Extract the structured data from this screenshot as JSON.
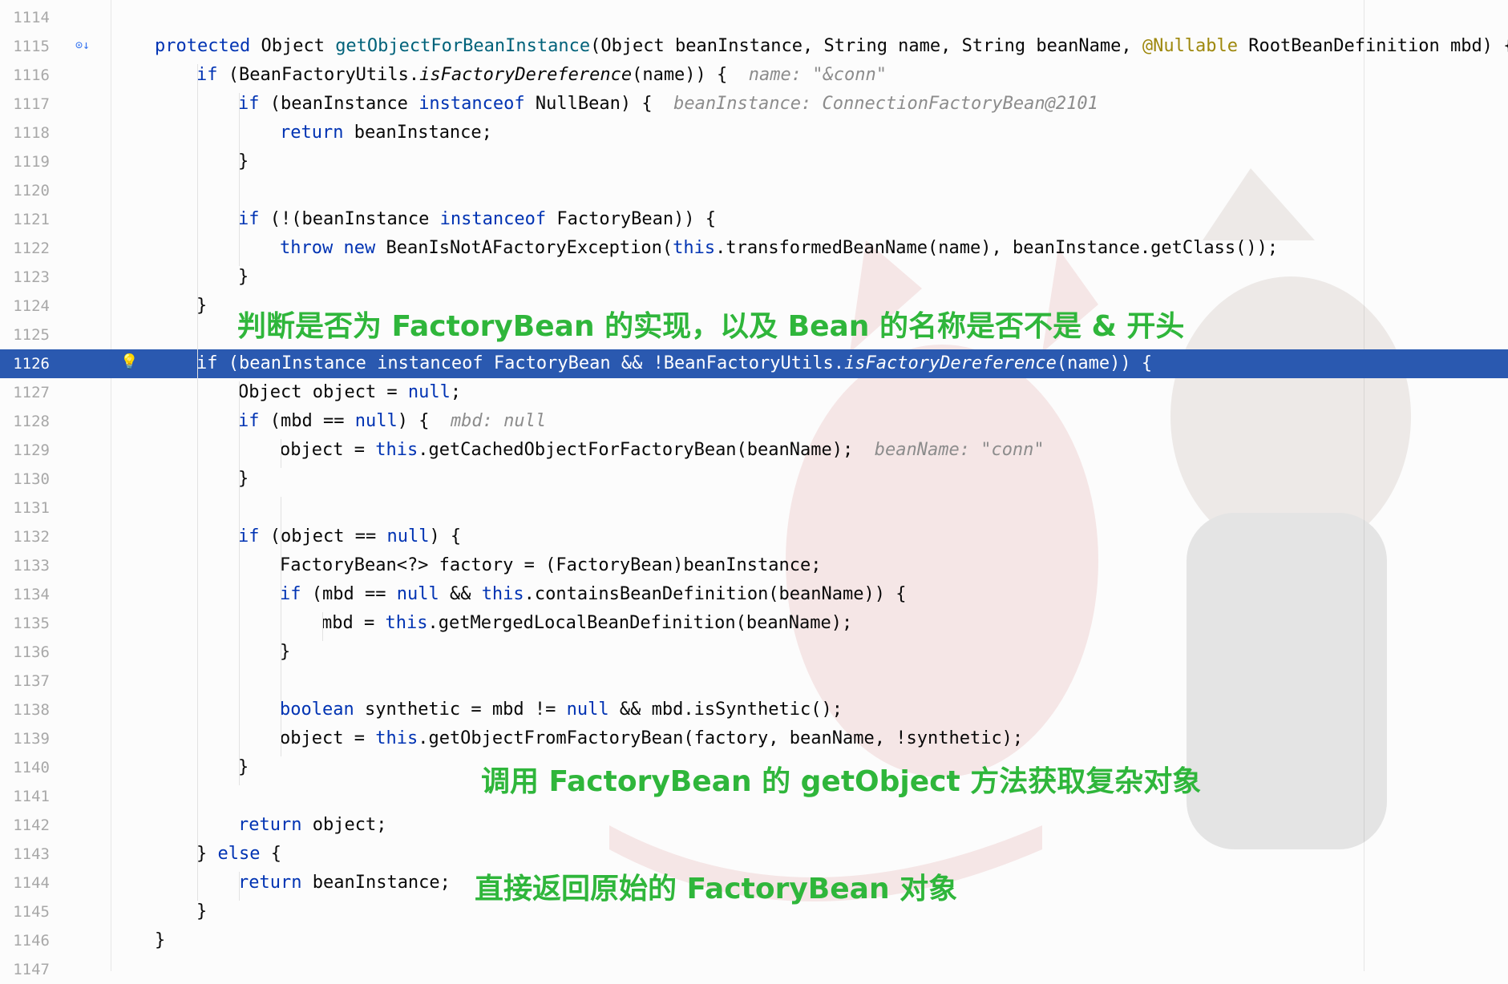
{
  "editor": {
    "lines": [
      {
        "num": "1114",
        "indent": 0,
        "tokens": []
      },
      {
        "num": "1115",
        "indent": 1,
        "tokens": [
          [
            "k",
            "protected"
          ],
          [
            "p",
            " Object "
          ],
          [
            "m",
            "getObjectForBeanInstance"
          ],
          [
            "p",
            "(Object beanInstance, String name, String beanName, "
          ],
          [
            "an",
            "@Nullable"
          ],
          [
            "p",
            " RootBeanDefinition mbd) {"
          ]
        ]
      },
      {
        "num": "1116",
        "indent": 2,
        "tokens": [
          [
            "k",
            "if"
          ],
          [
            "p",
            " (BeanFactoryUtils."
          ],
          [
            "i",
            "isFactoryDereference"
          ],
          [
            "p",
            "(name)) {  "
          ],
          [
            "h",
            "name: \"&conn\""
          ]
        ]
      },
      {
        "num": "1117",
        "indent": 3,
        "tokens": [
          [
            "k",
            "if"
          ],
          [
            "p",
            " (beanInstance "
          ],
          [
            "k",
            "instanceof"
          ],
          [
            "p",
            " NullBean) {  "
          ],
          [
            "h",
            "beanInstance: ConnectionFactoryBean@2101"
          ]
        ]
      },
      {
        "num": "1118",
        "indent": 4,
        "tokens": [
          [
            "k",
            "return"
          ],
          [
            "p",
            " beanInstance;"
          ]
        ]
      },
      {
        "num": "1119",
        "indent": 3,
        "tokens": [
          [
            "p",
            "}"
          ]
        ]
      },
      {
        "num": "1120",
        "indent": 0,
        "tokens": []
      },
      {
        "num": "1121",
        "indent": 3,
        "tokens": [
          [
            "k",
            "if"
          ],
          [
            "p",
            " (!(beanInstance "
          ],
          [
            "k",
            "instanceof"
          ],
          [
            "p",
            " FactoryBean)) {"
          ]
        ]
      },
      {
        "num": "1122",
        "indent": 4,
        "tokens": [
          [
            "k",
            "throw"
          ],
          [
            "p",
            " "
          ],
          [
            "k",
            "new"
          ],
          [
            "p",
            " BeanIsNotAFactoryException("
          ],
          [
            "k",
            "this"
          ],
          [
            "p",
            ".transformedBeanName(name), beanInstance.getClass());"
          ]
        ]
      },
      {
        "num": "1123",
        "indent": 3,
        "tokens": [
          [
            "p",
            "}"
          ]
        ]
      },
      {
        "num": "1124",
        "indent": 2,
        "tokens": [
          [
            "p",
            "}"
          ]
        ]
      },
      {
        "num": "1125",
        "indent": 0,
        "tokens": []
      },
      {
        "num": "1126",
        "indent": 2,
        "highlight": true,
        "tokens": [
          [
            "k",
            "if"
          ],
          [
            "p",
            " (beanInstance "
          ],
          [
            "k",
            "instanceof"
          ],
          [
            "p",
            " FactoryBean && !BeanFactoryUtils."
          ],
          [
            "i",
            "isFactoryDereference"
          ],
          [
            "p",
            "(name)) {"
          ]
        ]
      },
      {
        "num": "1127",
        "indent": 3,
        "tokens": [
          [
            "p",
            "Object object = "
          ],
          [
            "k",
            "null"
          ],
          [
            "p",
            ";"
          ]
        ]
      },
      {
        "num": "1128",
        "indent": 3,
        "tokens": [
          [
            "k",
            "if"
          ],
          [
            "p",
            " (mbd == "
          ],
          [
            "k",
            "null"
          ],
          [
            "p",
            ") {  "
          ],
          [
            "h",
            "mbd: null"
          ]
        ]
      },
      {
        "num": "1129",
        "indent": 4,
        "tokens": [
          [
            "p",
            "object = "
          ],
          [
            "k",
            "this"
          ],
          [
            "p",
            ".getCachedObjectForFactoryBean(beanName);  "
          ],
          [
            "h",
            "beanName: \"conn\""
          ]
        ]
      },
      {
        "num": "1130",
        "indent": 3,
        "tokens": [
          [
            "p",
            "}"
          ]
        ]
      },
      {
        "num": "1131",
        "indent": 0,
        "tokens": []
      },
      {
        "num": "1132",
        "indent": 3,
        "tokens": [
          [
            "k",
            "if"
          ],
          [
            "p",
            " (object == "
          ],
          [
            "k",
            "null"
          ],
          [
            "p",
            ") {"
          ]
        ]
      },
      {
        "num": "1133",
        "indent": 4,
        "tokens": [
          [
            "p",
            "FactoryBean<?> factory = (FactoryBean)beanInstance;"
          ]
        ]
      },
      {
        "num": "1134",
        "indent": 4,
        "tokens": [
          [
            "k",
            "if"
          ],
          [
            "p",
            " (mbd == "
          ],
          [
            "k",
            "null"
          ],
          [
            "p",
            " && "
          ],
          [
            "k",
            "this"
          ],
          [
            "p",
            ".containsBeanDefinition(beanName)) {"
          ]
        ]
      },
      {
        "num": "1135",
        "indent": 5,
        "tokens": [
          [
            "p",
            "mbd = "
          ],
          [
            "k",
            "this"
          ],
          [
            "p",
            ".getMergedLocalBeanDefinition(beanName);"
          ]
        ]
      },
      {
        "num": "1136",
        "indent": 4,
        "tokens": [
          [
            "p",
            "}"
          ]
        ]
      },
      {
        "num": "1137",
        "indent": 0,
        "tokens": []
      },
      {
        "num": "1138",
        "indent": 4,
        "tokens": [
          [
            "k",
            "boolean"
          ],
          [
            "p",
            " synthetic = mbd != "
          ],
          [
            "k",
            "null"
          ],
          [
            "p",
            " && mbd.isSynthetic();"
          ]
        ]
      },
      {
        "num": "1139",
        "indent": 4,
        "tokens": [
          [
            "p",
            "object = "
          ],
          [
            "k",
            "this"
          ],
          [
            "p",
            ".getObjectFromFactoryBean(factory, beanName, !synthetic);"
          ]
        ]
      },
      {
        "num": "1140",
        "indent": 3,
        "tokens": [
          [
            "p",
            "}"
          ]
        ]
      },
      {
        "num": "1141",
        "indent": 0,
        "tokens": []
      },
      {
        "num": "1142",
        "indent": 3,
        "tokens": [
          [
            "k",
            "return"
          ],
          [
            "p",
            " object;"
          ]
        ]
      },
      {
        "num": "1143",
        "indent": 2,
        "tokens": [
          [
            "p",
            "} "
          ],
          [
            "k",
            "else"
          ],
          [
            "p",
            " {"
          ]
        ]
      },
      {
        "num": "1144",
        "indent": 3,
        "tokens": [
          [
            "k",
            "return"
          ],
          [
            "p",
            " beanInstance;"
          ]
        ]
      },
      {
        "num": "1145",
        "indent": 2,
        "tokens": [
          [
            "p",
            "}"
          ]
        ]
      },
      {
        "num": "1146",
        "indent": 1,
        "tokens": [
          [
            "p",
            "}"
          ]
        ]
      },
      {
        "num": "1147",
        "indent": 0,
        "tokens": []
      }
    ]
  },
  "gutter_icons": {
    "debug_step_icon": "⊙↓",
    "bulb_icon": "💡"
  },
  "annotations": {
    "note1": "判断是否为 FactoryBean 的实现，以及 Bean 的名称是否不是 & 开头",
    "note2": "调用 FactoryBean 的 getObject 方法获取复杂对象",
    "note3": "直接返回原始的 FactoryBean 对象"
  },
  "colors": {
    "keyword": "#0033b3",
    "method": "#00627a",
    "annotation": "#9e880d",
    "highlight_line": "#2a59b0",
    "caption": "#2fb63b"
  }
}
